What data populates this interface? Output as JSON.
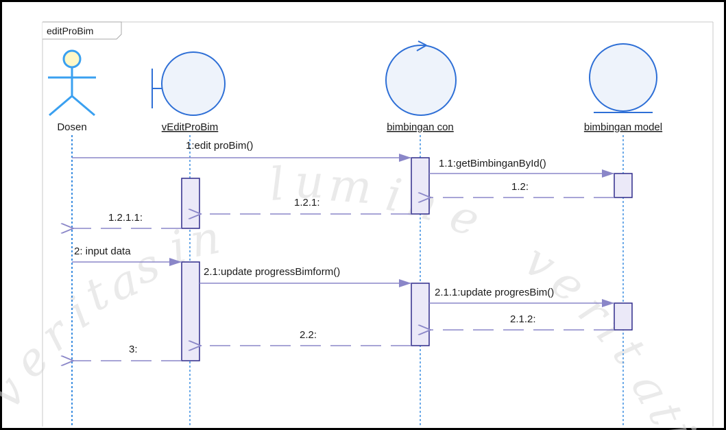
{
  "frame": {
    "label": "editProBim"
  },
  "lifelines": [
    {
      "id": "dosen",
      "name": "Dosen",
      "kind": "actor"
    },
    {
      "id": "view",
      "name": "vEditProBim",
      "kind": "boundary"
    },
    {
      "id": "con",
      "name": "bimbingan con",
      "kind": "control"
    },
    {
      "id": "model",
      "name": "bimbingan model",
      "kind": "entity"
    }
  ],
  "messages": [
    {
      "label": "1:edit proBim()",
      "type": "call"
    },
    {
      "label": "1.1:getBimbinganById()",
      "type": "call"
    },
    {
      "label": "1.2:",
      "type": "return"
    },
    {
      "label": "1.2.1:",
      "type": "return"
    },
    {
      "label": "1.2.1.1:",
      "type": "return"
    },
    {
      "label": "2: input data",
      "type": "call"
    },
    {
      "label": "2.1:update progressBimform()",
      "type": "call"
    },
    {
      "label": "2.1.1:update progresBim()",
      "type": "call"
    },
    {
      "label": "2.1.2:",
      "type": "return"
    },
    {
      "label": "2.2:",
      "type": "return"
    },
    {
      "label": "3:",
      "type": "return"
    }
  ],
  "watermark": {
    "letters": [
      "v",
      "e",
      "r",
      "i",
      "t",
      "a",
      "s",
      "i",
      "n",
      "l",
      "u",
      "m",
      "i",
      "n",
      "e",
      "v",
      "e",
      "r",
      "i",
      "t",
      "a",
      "t",
      "i"
    ]
  },
  "colors": {
    "actor_stroke": "#3aa0f0",
    "actor_head": "#fff8c8",
    "object_fill": "#eef3fb",
    "object_stroke": "#2e6fd6",
    "lifeline": "#3b8de0",
    "message": "#8a86c8",
    "activation_fill": "#ebe9f8",
    "activation_stroke": "#2f2a8a",
    "frame": "#c8c8c8"
  }
}
